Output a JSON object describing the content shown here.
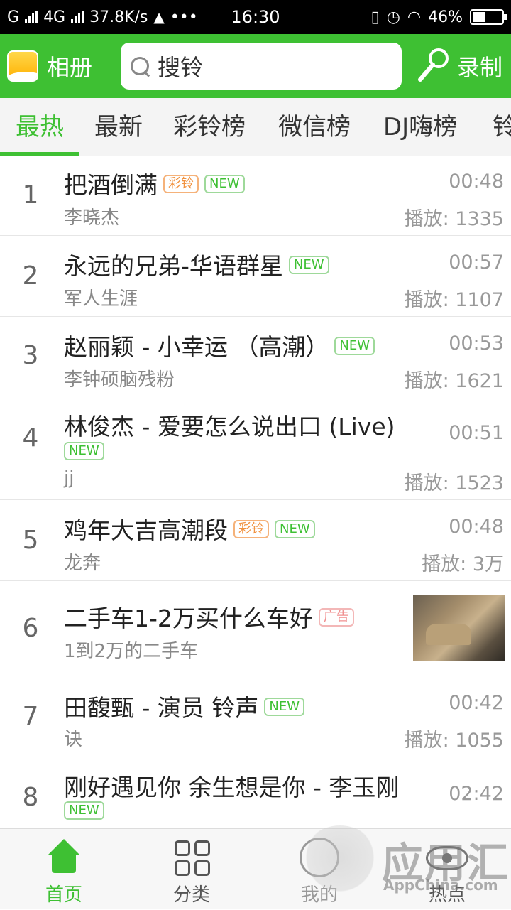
{
  "status_bar": {
    "carrier": "G",
    "network": "4G",
    "speed": "37.8K/s",
    "dots": "•••",
    "time": "16:30",
    "battery_pct": "46%",
    "battery_level": 0.46
  },
  "header": {
    "album_label": "相册",
    "search_placeholder": "搜铃",
    "record_label": "录制",
    "accent_color": "#3ec033"
  },
  "tabs": [
    {
      "label": "最热",
      "active": true
    },
    {
      "label": "最新"
    },
    {
      "label": "彩铃榜"
    },
    {
      "label": "微信榜"
    },
    {
      "label": "DJ嗨榜"
    },
    {
      "label": "铃"
    }
  ],
  "badges": {
    "new": "NEW",
    "caiLing": "彩铃",
    "ad": "广告"
  },
  "songs": [
    {
      "rank": "1",
      "title": "把酒倒满",
      "artist": "李晓杰",
      "duration": "00:48",
      "plays": "播放: 1335"
    },
    {
      "rank": "2",
      "title": "永远的兄弟-华语群星",
      "artist": "军人生涯",
      "duration": "00:57",
      "plays": "播放: 1107"
    },
    {
      "rank": "3",
      "title": "赵丽颖 - 小幸运 （高潮）",
      "artist": "李钟硕脑残粉",
      "duration": "00:53",
      "plays": "播放: 1621"
    },
    {
      "rank": "4",
      "title": "林俊杰 - 爱要怎么说出口 (Live)",
      "artist": "jj",
      "duration": "00:51",
      "plays": "播放: 1523"
    },
    {
      "rank": "5",
      "title": "鸡年大吉高潮段",
      "artist": "龙奔",
      "duration": "00:48",
      "plays": "播放: 3万"
    },
    {
      "rank": "6",
      "title": "二手车1-2万买什么车好",
      "artist": "1到2万的二手车"
    },
    {
      "rank": "7",
      "title": "田馥甄 - 演员 铃声",
      "artist": "诀",
      "duration": "00:42",
      "plays": "播放: 1055"
    },
    {
      "rank": "8",
      "title": "刚好遇见你 余生想是你 - 李玉刚",
      "duration": "02:42"
    }
  ],
  "bottom_nav": [
    {
      "label": "首页",
      "icon": "home-icon"
    },
    {
      "label": "分类",
      "icon": "grid-icon"
    },
    {
      "label": "我的",
      "icon": "user-icon"
    },
    {
      "label": "热点",
      "icon": "eye-icon"
    }
  ],
  "watermark": {
    "text": "应用汇",
    "sub": "AppChina.com"
  }
}
